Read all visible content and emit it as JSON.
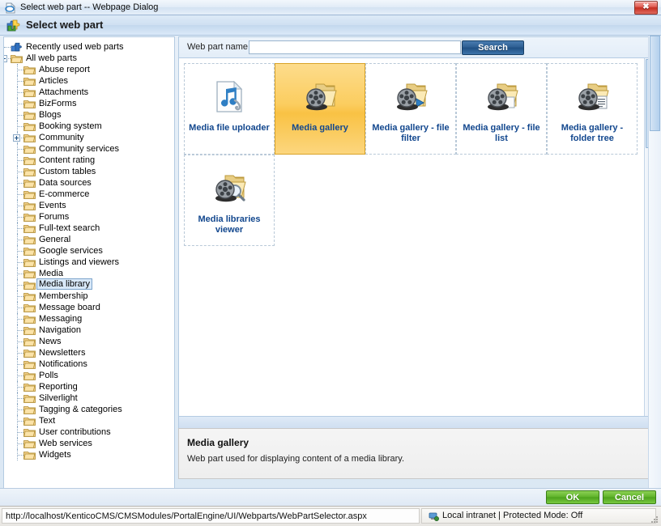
{
  "window": {
    "title": "Select web part -- Webpage Dialog",
    "icon": "ie-page-icon",
    "close_label": "✖"
  },
  "header": {
    "title": "Select web part",
    "icon": "webpart-puzzle-icon"
  },
  "search": {
    "label": "Web part name:",
    "value": "",
    "placeholder": "",
    "button_label": "Search"
  },
  "tree": {
    "items": [
      {
        "label": "Recently used web parts",
        "level": 0,
        "icon": "recent-webparts-icon",
        "toggle": "none",
        "selected": false
      },
      {
        "label": "All web parts",
        "level": 0,
        "icon": "folder-icon",
        "toggle": "minus",
        "selected": false
      },
      {
        "label": "Abuse report",
        "level": 1,
        "icon": "folder-icon",
        "toggle": "none",
        "selected": false
      },
      {
        "label": "Articles",
        "level": 1,
        "icon": "folder-icon",
        "toggle": "none",
        "selected": false
      },
      {
        "label": "Attachments",
        "level": 1,
        "icon": "folder-icon",
        "toggle": "none",
        "selected": false
      },
      {
        "label": "BizForms",
        "level": 1,
        "icon": "folder-icon",
        "toggle": "none",
        "selected": false
      },
      {
        "label": "Blogs",
        "level": 1,
        "icon": "folder-icon",
        "toggle": "none",
        "selected": false
      },
      {
        "label": "Booking system",
        "level": 1,
        "icon": "folder-icon",
        "toggle": "none",
        "selected": false
      },
      {
        "label": "Community",
        "level": 1,
        "icon": "folder-icon",
        "toggle": "plus",
        "selected": false
      },
      {
        "label": "Community services",
        "level": 1,
        "icon": "folder-icon",
        "toggle": "none",
        "selected": false
      },
      {
        "label": "Content rating",
        "level": 1,
        "icon": "folder-icon",
        "toggle": "none",
        "selected": false
      },
      {
        "label": "Custom tables",
        "level": 1,
        "icon": "folder-icon",
        "toggle": "none",
        "selected": false
      },
      {
        "label": "Data sources",
        "level": 1,
        "icon": "folder-icon",
        "toggle": "none",
        "selected": false
      },
      {
        "label": "E-commerce",
        "level": 1,
        "icon": "folder-icon",
        "toggle": "none",
        "selected": false
      },
      {
        "label": "Events",
        "level": 1,
        "icon": "folder-icon",
        "toggle": "none",
        "selected": false
      },
      {
        "label": "Forums",
        "level": 1,
        "icon": "folder-icon",
        "toggle": "none",
        "selected": false
      },
      {
        "label": "Full-text search",
        "level": 1,
        "icon": "folder-icon",
        "toggle": "none",
        "selected": false
      },
      {
        "label": "General",
        "level": 1,
        "icon": "folder-icon",
        "toggle": "none",
        "selected": false
      },
      {
        "label": "Google services",
        "level": 1,
        "icon": "folder-icon",
        "toggle": "none",
        "selected": false
      },
      {
        "label": "Listings and viewers",
        "level": 1,
        "icon": "folder-icon",
        "toggle": "none",
        "selected": false
      },
      {
        "label": "Media",
        "level": 1,
        "icon": "folder-icon",
        "toggle": "none",
        "selected": false
      },
      {
        "label": "Media library",
        "level": 1,
        "icon": "folder-icon",
        "toggle": "none",
        "selected": true
      },
      {
        "label": "Membership",
        "level": 1,
        "icon": "folder-icon",
        "toggle": "none",
        "selected": false
      },
      {
        "label": "Message board",
        "level": 1,
        "icon": "folder-icon",
        "toggle": "none",
        "selected": false
      },
      {
        "label": "Messaging",
        "level": 1,
        "icon": "folder-icon",
        "toggle": "none",
        "selected": false
      },
      {
        "label": "Navigation",
        "level": 1,
        "icon": "folder-icon",
        "toggle": "none",
        "selected": false
      },
      {
        "label": "News",
        "level": 1,
        "icon": "folder-icon",
        "toggle": "none",
        "selected": false
      },
      {
        "label": "Newsletters",
        "level": 1,
        "icon": "folder-icon",
        "toggle": "none",
        "selected": false
      },
      {
        "label": "Notifications",
        "level": 1,
        "icon": "folder-icon",
        "toggle": "none",
        "selected": false
      },
      {
        "label": "Polls",
        "level": 1,
        "icon": "folder-icon",
        "toggle": "none",
        "selected": false
      },
      {
        "label": "Reporting",
        "level": 1,
        "icon": "folder-icon",
        "toggle": "none",
        "selected": false
      },
      {
        "label": "Silverlight",
        "level": 1,
        "icon": "folder-icon",
        "toggle": "none",
        "selected": false
      },
      {
        "label": "Tagging & categories",
        "level": 1,
        "icon": "folder-icon",
        "toggle": "none",
        "selected": false
      },
      {
        "label": "Text",
        "level": 1,
        "icon": "folder-icon",
        "toggle": "none",
        "selected": false
      },
      {
        "label": "User contributions",
        "level": 1,
        "icon": "folder-icon",
        "toggle": "none",
        "selected": false
      },
      {
        "label": "Web services",
        "level": 1,
        "icon": "folder-icon",
        "toggle": "none",
        "selected": false
      },
      {
        "label": "Widgets",
        "level": 1,
        "icon": "folder-icon",
        "toggle": "none",
        "selected": false
      }
    ]
  },
  "gallery": {
    "cards": [
      {
        "label": "Media file uploader",
        "icon": "media-file-uploader-icon",
        "selected": false
      },
      {
        "label": "Media gallery",
        "icon": "media-gallery-icon",
        "selected": true
      },
      {
        "label": "Media gallery - file filter",
        "icon": "media-gallery-file-filter-icon",
        "selected": false
      },
      {
        "label": "Media gallery - file list",
        "icon": "media-gallery-file-list-icon",
        "selected": false
      },
      {
        "label": "Media gallery - folder tree",
        "icon": "media-gallery-folder-tree-icon",
        "selected": false
      },
      {
        "label": "Media libraries viewer",
        "icon": "media-libraries-viewer-icon",
        "selected": false
      }
    ]
  },
  "description": {
    "title": "Media gallery",
    "text": "Web part used for displaying content of a media library."
  },
  "footer": {
    "ok_label": "OK",
    "cancel_label": "Cancel"
  },
  "statusbar": {
    "url": "http://localhost/KenticoCMS/CMSModules/PortalEngine/UI/Webparts/WebPartSelector.aspx",
    "zone": "Local intranet | Protected Mode: Off",
    "zone_icon": "local-intranet-icon"
  },
  "colors": {
    "accent_blue": "#12478e",
    "selected_card": "#f9c244",
    "ok_green": "#4da31d",
    "close_red": "#c62f22"
  }
}
